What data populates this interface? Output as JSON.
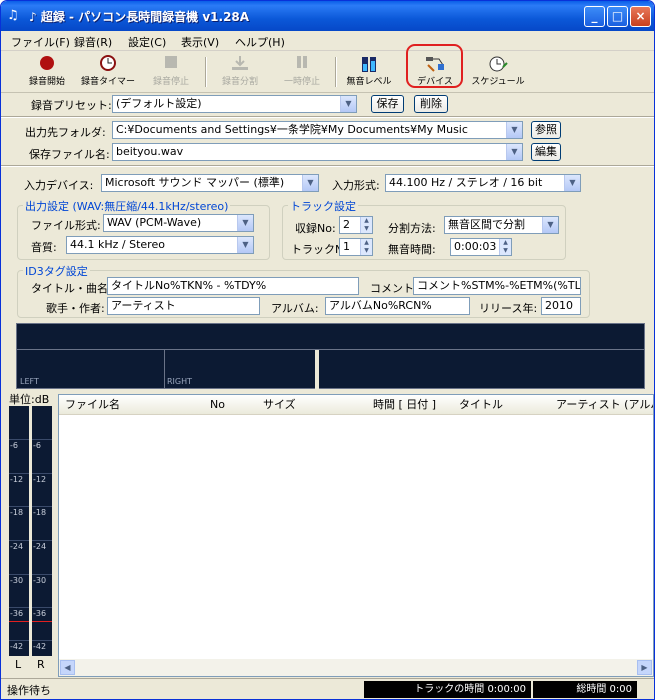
{
  "window": {
    "title": "♪ 超録 - パソコン長時間録音機 v1.28A",
    "icon": "note-icon",
    "min": "_",
    "max": "□",
    "close": "×"
  },
  "menu": [
    "ファイル(F)",
    "録音(R)",
    "設定(C)",
    "表示(V)",
    "ヘルプ(H)"
  ],
  "toolbar": {
    "record": "録音開始",
    "timer": "録音タイマー",
    "stop": "録音停止",
    "split": "録音分割",
    "pause": "一時停止",
    "level": "無音レベル",
    "device": "デバイス",
    "schedule": "スケジュール"
  },
  "preset": {
    "label": "録音プリセット:",
    "value": "(デフォルト設定)",
    "save": "保存",
    "delete": "削除"
  },
  "output": {
    "folder_label": "出力先フォルダ:",
    "folder": "C:¥Documents and Settings¥一条学院¥My Documents¥My Music",
    "ref": "参照",
    "file_label": "保存ファイル名:",
    "file": "beityou.wav",
    "edit": "編集"
  },
  "input": {
    "device_label": "入力デバイス:",
    "device": "Microsoft サウンド マッパー (標準)",
    "format_label": "入力形式:",
    "format": "44.100 Hz / ステレオ / 16 bit"
  },
  "outset": {
    "title": "出力設定 (WAV:無圧縮/44.1kHz/stereo)",
    "fmt_label": "ファイル形式:",
    "fmt": "WAV (PCM-Wave)",
    "q_label": "音質:",
    "q": "44.1 kHz / Stereo"
  },
  "track": {
    "title": "トラック設定",
    "rec_label": "収録No:",
    "rec": "2",
    "tr_label": "トラックNo:",
    "tr": "1",
    "split_label": "分割方法:",
    "split": "無音区間で分割",
    "silence_label": "無音時間:",
    "silence": "0:00:03"
  },
  "id3": {
    "title": "ID3タグ設定",
    "title_label": "タイトル・曲名:",
    "title_val": "タイトルNo%TKN% - %TDY%",
    "comment_label": "コメント:",
    "comment": "コメント%STM%-%ETM%(%TLN%)",
    "artist_label": "歌手・作者:",
    "artist": "アーティスト",
    "album_label": "アルバム:",
    "album": "アルバムNo%RCN%",
    "year_label": "リリース年:",
    "year": "2010"
  },
  "meter": {
    "left": "LEFT",
    "right": "RIGHT"
  },
  "vu": {
    "unit": "単位:dB",
    "ticks": [
      "-6",
      "-12",
      "-18",
      "-24",
      "-30",
      "-36",
      "-42"
    ],
    "l": "L",
    "r": "R"
  },
  "list": {
    "columns": [
      "ファイル名",
      "No",
      "サイズ",
      "時間 [ 日付 ]",
      "タイトル",
      "アーティスト (アルバム)"
    ]
  },
  "status": {
    "text": "操作待ち",
    "track_time": "トラックの時間 0:00:00",
    "total_time": "総時間 0:00"
  }
}
